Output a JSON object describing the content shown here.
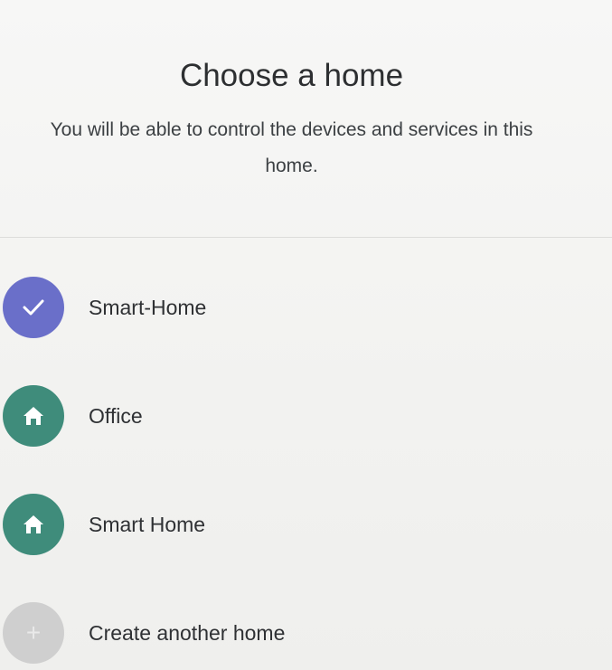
{
  "page": {
    "title": "Choose a home",
    "subtitle": "You will be able to control the devices and services in this home."
  },
  "homes": [
    {
      "label": "Smart-Home",
      "icon": "check-icon",
      "selected": true
    },
    {
      "label": "Office",
      "icon": "home-icon",
      "selected": false
    },
    {
      "label": "Smart Home",
      "icon": "home-icon",
      "selected": false
    }
  ],
  "create": {
    "label": "Create another home",
    "icon": "plus-icon"
  },
  "colors": {
    "selected": "#6a6fc9",
    "home": "#3f8c7b",
    "create": "#cfcfcf"
  }
}
